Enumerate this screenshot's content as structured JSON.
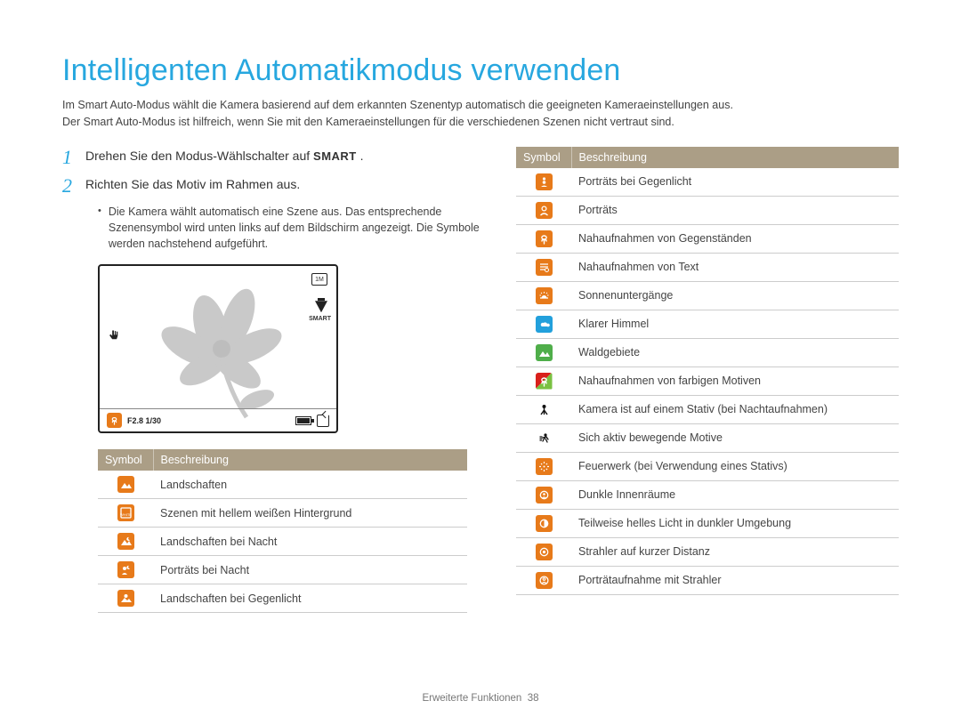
{
  "title": "Intelligenten Automatikmodus verwenden",
  "intro_line1": "Im Smart Auto-Modus wählt die Kamera basierend auf dem erkannten Szenentyp automatisch die geeigneten Kameraeinstellungen aus.",
  "intro_line2": "Der Smart Auto-Modus ist hilfreich, wenn Sie mit den Kameraeinstellungen für die verschiedenen Szenen nicht vertraut sind.",
  "step1": {
    "num": "1",
    "pre": "Drehen Sie den Modus-Wählschalter auf ",
    "smart": "SMART",
    "post": " ."
  },
  "step2": {
    "num": "2",
    "text": "Richten Sie das Motiv im Rahmen aus."
  },
  "bullet": "Die Kamera wählt automatisch eine Szene aus. Das entsprechende Szenensymbol wird unten links auf dem Bildschirm angezeigt. Die Symbole werden nachstehend aufgeführt.",
  "cam": {
    "top": "1M",
    "exposure": "F2.8  1/30",
    "smart_label": "SMART"
  },
  "headers": {
    "symbol": "Symbol",
    "desc": "Beschreibung"
  },
  "left_rows": [
    {
      "icon": "landscape",
      "color": "orange",
      "desc": "Landschaften"
    },
    {
      "icon": "white",
      "color": "orange",
      "desc": "Szenen mit hellem weißen Hintergrund"
    },
    {
      "icon": "night-landscape",
      "color": "orange",
      "desc": "Landschaften bei Nacht"
    },
    {
      "icon": "night-portrait",
      "color": "orange",
      "desc": "Porträts bei Nacht"
    },
    {
      "icon": "backlight-landscape",
      "color": "orange",
      "desc": "Landschaften bei Gegenlicht"
    }
  ],
  "right_rows": [
    {
      "icon": "backlight-portrait",
      "color": "orange",
      "desc": "Porträts bei Gegenlicht"
    },
    {
      "icon": "portrait",
      "color": "orange",
      "desc": "Porträts"
    },
    {
      "icon": "macro-object",
      "color": "orange",
      "desc": "Nahaufnahmen von Gegenständen"
    },
    {
      "icon": "macro-text",
      "color": "orange",
      "desc": "Nahaufnahmen von Text"
    },
    {
      "icon": "sunset",
      "color": "orange",
      "desc": "Sonnenuntergänge"
    },
    {
      "icon": "bluesky",
      "color": "blue",
      "desc": "Klarer Himmel"
    },
    {
      "icon": "forest",
      "color": "green",
      "desc": "Waldgebiete"
    },
    {
      "icon": "macro-color",
      "color": "dual",
      "desc": "Nahaufnahmen von farbigen Motiven"
    },
    {
      "icon": "tripod",
      "color": "none",
      "desc": "Kamera ist auf einem Stativ (bei Nachtaufnahmen)"
    },
    {
      "icon": "action",
      "color": "none",
      "desc": "Sich aktiv bewegende Motive"
    },
    {
      "icon": "fireworks",
      "color": "orange",
      "desc": "Feuerwerk (bei Verwendung eines Stativs)"
    },
    {
      "icon": "indoor",
      "color": "orange",
      "desc": "Dunkle Innenräume"
    },
    {
      "icon": "partial-light",
      "color": "orange",
      "desc": "Teilweise helles Licht in dunkler Umgebung"
    },
    {
      "icon": "spotlight",
      "color": "orange",
      "desc": "Strahler auf kurzer Distanz"
    },
    {
      "icon": "portrait-spot",
      "color": "orange",
      "desc": "Porträtaufnahme mit Strahler"
    }
  ],
  "footer": {
    "section": "Erweiterte Funktionen",
    "page": "38"
  }
}
